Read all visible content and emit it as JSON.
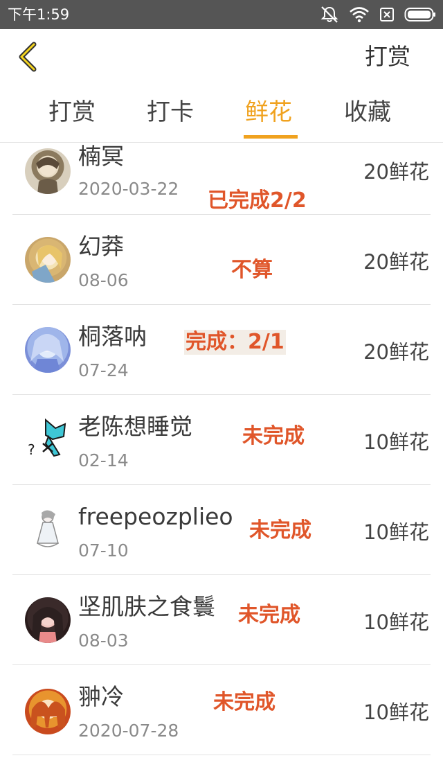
{
  "status_bar": {
    "time": "下午1:59",
    "icons": [
      "mute-icon",
      "wifi-icon",
      "sim-icon",
      "battery-icon"
    ]
  },
  "nav": {
    "back_icon": "back-icon",
    "action": "打赏"
  },
  "tabs": [
    {
      "label": "打赏",
      "active": false
    },
    {
      "label": "打卡",
      "active": false
    },
    {
      "label": "鲜花",
      "active": true
    },
    {
      "label": "收藏",
      "active": false
    }
  ],
  "accent_color": "#f0a21f",
  "note_color": "#e0562a",
  "list": [
    {
      "name": "楠冥",
      "date": "2020-03-22",
      "amount": "20鲜花",
      "note": "已完成2/2"
    },
    {
      "name": "幻莽",
      "date": "08-06",
      "amount": "20鲜花",
      "note": "不算"
    },
    {
      "name": "桐落呐",
      "date": "07-24",
      "amount": "20鲜花",
      "note": "完成：2/1"
    },
    {
      "name": "老陈想睡觉",
      "date": "02-14",
      "amount": "10鲜花",
      "note": "未完成"
    },
    {
      "name": "freepeozplieo",
      "date": "07-10",
      "amount": "10鲜花",
      "note": "未完成"
    },
    {
      "name": "坚肌肤之食鬟",
      "date": "08-03",
      "amount": "10鲜花",
      "note": "未完成"
    },
    {
      "name": "翀冷",
      "date": "2020-07-28",
      "amount": "10鲜花",
      "note": "未完成"
    }
  ]
}
